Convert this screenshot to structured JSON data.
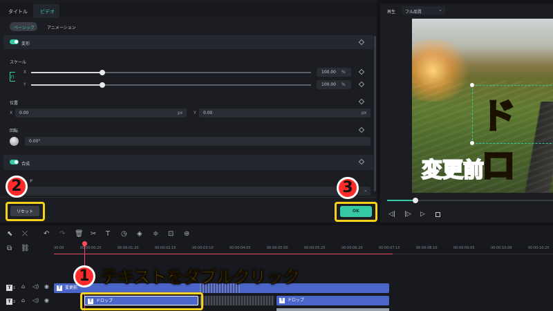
{
  "tabs": [
    {
      "label": "タイトル"
    },
    {
      "label": "ビデオ"
    }
  ],
  "subtabs": [
    {
      "label": "ベーシック"
    },
    {
      "label": "アニメーション"
    }
  ],
  "transform": {
    "section": "変形",
    "scale_label": "スケール",
    "x_axis": "X",
    "y_axis": "Y",
    "scale_x_value": "100.00",
    "scale_y_value": "100.00",
    "scale_x": 1.0,
    "scale_y": 1.0,
    "percent": "%",
    "position_label": "位置",
    "pos_x_label": "X",
    "pos_x_value": "0.00",
    "pos_y_label": "Y",
    "pos_y_value": "0.00",
    "px": "px",
    "rotation_label": "回転",
    "rotation_value": "0.00°"
  },
  "composite": {
    "section": "合成",
    "blend_partial": "ド"
  },
  "buttons": {
    "reset": "リセット",
    "ok": "OK"
  },
  "preview": {
    "play_label": "再生",
    "quality": "フル品質",
    "overlay_text": "ドロ",
    "before_label": "変更前"
  },
  "annotations": {
    "step1_number": "1",
    "step1_text": "テキストをダブルクリック",
    "step2_number": "2",
    "step3_number": "3"
  },
  "timeline": {
    "ticks": [
      "00:00",
      "00:00:00:25",
      "00:00:01:20",
      "00:00:02:15",
      "00:00:03:10",
      "00:00:04:05",
      "00:00:05:00",
      "00:00:05:25",
      "00:00:06:20",
      "00:00:07:15",
      "00:00:08:10",
      "00:00:09:05",
      "00:00:10:00",
      "00:00:10:25"
    ],
    "track1_label": "1",
    "track2_label": "2",
    "clip_top": "変更前",
    "clip_drop1": "ドロップ",
    "clip_drop2": "ドロップ"
  },
  "colors": {
    "accent": "#35c9a6",
    "highlight": "#f7d21a",
    "callout": "#ff2a2a",
    "clip": "#4b66c9"
  }
}
